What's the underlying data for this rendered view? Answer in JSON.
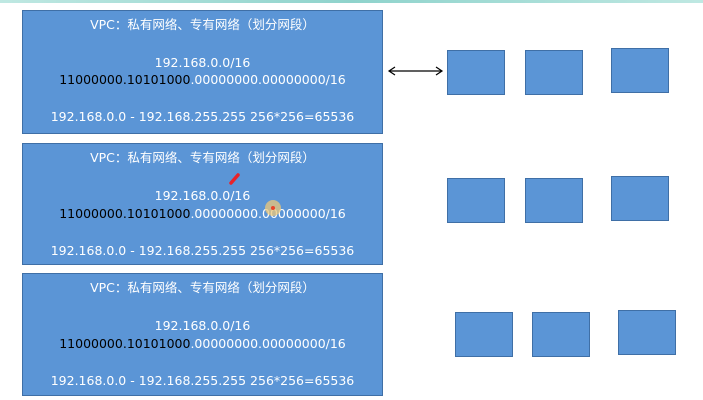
{
  "blocks": [
    {
      "title": "VPC：私有网络、专有网络（划分网段）",
      "cidr": "192.168.0.0/16",
      "binary_network": "11000000.10101000",
      "binary_host": ".00000000.00000000/16",
      "range": "192.168.0.0 - 192.168.255.255   256*256=65536"
    },
    {
      "title": "VPC：私有网络、专有网络（划分网段）",
      "cidr": "192.168.0.0/16",
      "binary_network": "11000000.10101000",
      "binary_host": ".00000000.00000000/16",
      "range": "192.168.0.0 - 192.168.255.255   256*256=65536"
    },
    {
      "title": "VPC：私有网络、专有网络（划分网段）",
      "cidr": "192.168.0.0/16",
      "binary_network": "11000000.10101000",
      "binary_host": ".00000000.00000000/16",
      "range": "192.168.0.0 - 192.168.255.255   256*256=65536"
    }
  ],
  "colors": {
    "box_fill": "#5b95d6",
    "box_border": "#3f6fa6",
    "text_light": "#ffffff",
    "text_dark": "#000000",
    "arrow": "#000000",
    "annotation_mark": "#e8232a"
  }
}
